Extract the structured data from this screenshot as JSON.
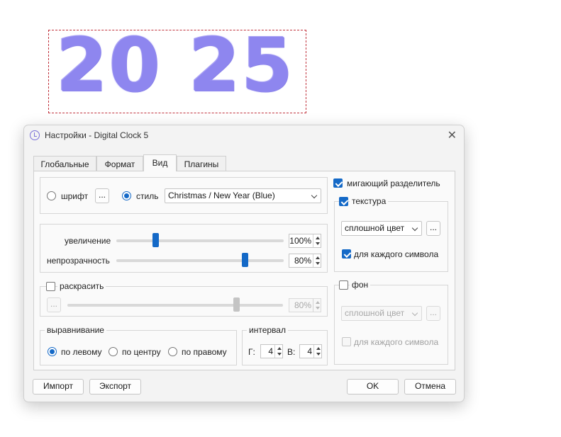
{
  "preview": {
    "clock_text": "20 25",
    "color": "#8e86ef"
  },
  "window": {
    "title": "Настройки - Digital Clock 5",
    "close_glyph": "✕"
  },
  "tabs": [
    {
      "label": "Глобальные"
    },
    {
      "label": "Формат"
    },
    {
      "label": "Вид",
      "active": true
    },
    {
      "label": "Плагины"
    }
  ],
  "font_row": {
    "font_label": "шрифт",
    "font_button": "...",
    "style_label": "стиль",
    "style_value": "Christmas / New Year (Blue)",
    "selected": "стиль"
  },
  "sliders": {
    "zoom_label": "увеличение",
    "zoom_value": "100%",
    "opacity_label": "непрозрачность",
    "opacity_value": "80%"
  },
  "colorize": {
    "label": "раскрасить",
    "checked": false,
    "button": "...",
    "value": "80%"
  },
  "alignment": {
    "title": "выравнивание",
    "options": [
      "по левому",
      "по центру",
      "по правому"
    ],
    "selected": "по левому"
  },
  "interval": {
    "title": "интервал",
    "h_label": "Г:",
    "h_value": "4",
    "v_label": "В:",
    "v_value": "4"
  },
  "right": {
    "blink_separator": "мигающий разделитель",
    "texture_label": "текстура",
    "texture_mode": "сплошной цвет",
    "texture_button": "...",
    "texture_per_char": "для каждого символа",
    "bg_label": "фон",
    "bg_mode": "сплошной цвет",
    "bg_button": "...",
    "bg_per_char": "для каждого символа"
  },
  "footer": {
    "import": "Импорт",
    "export": "Экспорт",
    "ok": "OK",
    "cancel": "Отмена"
  },
  "colors": {
    "accent": "#1469c7",
    "frame": "#c0303a"
  }
}
